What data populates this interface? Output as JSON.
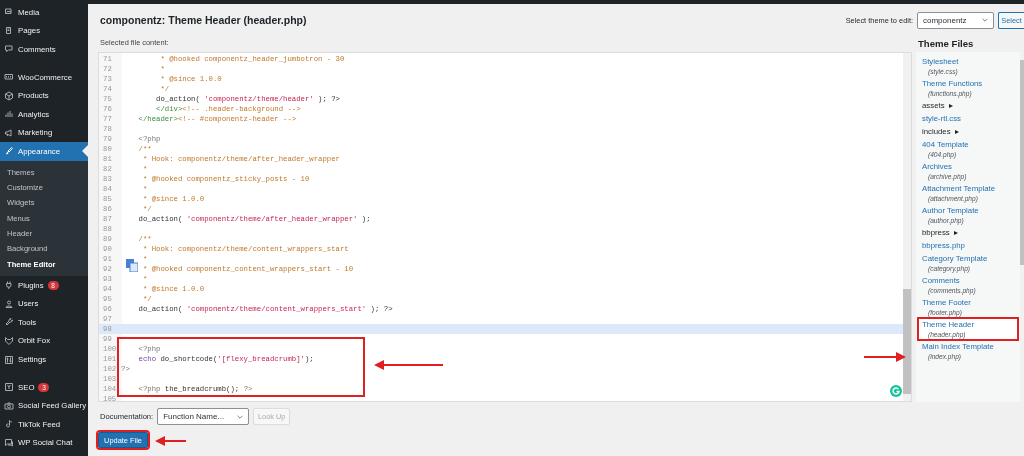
{
  "sidebar": {
    "sections": [
      {
        "items": [
          {
            "label": "Media",
            "selected": false
          },
          {
            "label": "Pages",
            "selected": false
          },
          {
            "label": "Comments",
            "selected": false
          }
        ]
      },
      {
        "items": [
          {
            "label": "WooCommerce",
            "selected": false
          },
          {
            "label": "Products",
            "selected": false
          },
          {
            "label": "Analytics",
            "selected": false
          },
          {
            "label": "Marketing",
            "selected": false
          },
          {
            "label": "Appearance",
            "selected": true,
            "children": [
              {
                "label": "Themes",
                "selected": false
              },
              {
                "label": "Customize",
                "selected": false
              },
              {
                "label": "Widgets",
                "selected": false
              },
              {
                "label": "Menus",
                "selected": false
              },
              {
                "label": "Header",
                "selected": false
              },
              {
                "label": "Background",
                "selected": false
              },
              {
                "label": "Theme Editor",
                "selected": true
              }
            ]
          },
          {
            "label": "Plugins",
            "selected": false,
            "badge": "8"
          },
          {
            "label": "Users",
            "selected": false
          },
          {
            "label": "Tools",
            "selected": false
          },
          {
            "label": "Orbit Fox",
            "selected": false
          },
          {
            "label": "Settings",
            "selected": false
          }
        ]
      },
      {
        "items": [
          {
            "label": "SEO",
            "selected": false,
            "badge": "3"
          },
          {
            "label": "Social Feed Gallery",
            "selected": false
          },
          {
            "label": "TikTok Feed",
            "selected": false
          },
          {
            "label": "WP Social Chat",
            "selected": false
          }
        ]
      }
    ]
  },
  "title": "componentz: Theme Header (header.php)",
  "theme_select": {
    "label": "Select theme to edit:",
    "value": "componentz",
    "button": "Select"
  },
  "editor": {
    "label": "Selected file content:",
    "lines": [
      {
        "number": "71",
        "active": false,
        "tokens": [
          {
            "kind": "comment",
            "text": "         * @hooked componentz_header_jumbotron - 30"
          }
        ]
      },
      {
        "number": "72",
        "active": false,
        "tokens": [
          {
            "kind": "comment",
            "text": "         *"
          }
        ]
      },
      {
        "number": "73",
        "active": false,
        "tokens": [
          {
            "kind": "comment",
            "text": "         * @since 1.0.0"
          }
        ]
      },
      {
        "number": "74",
        "active": false,
        "tokens": [
          {
            "kind": "comment",
            "text": "         */"
          }
        ]
      },
      {
        "number": "75",
        "active": false,
        "tokens": [
          {
            "kind": "plain",
            "text": "        do_action( "
          },
          {
            "kind": "string",
            "text": "'componentz/theme/header'"
          },
          {
            "kind": "plain",
            "text": " ); ?>"
          }
        ]
      },
      {
        "number": "76",
        "active": false,
        "tokens": [
          {
            "kind": "tag",
            "text": "        </div>"
          },
          {
            "kind": "comment",
            "text": "<!-- .header-background -->"
          }
        ]
      },
      {
        "number": "77",
        "active": false,
        "tokens": [
          {
            "kind": "tag",
            "text": "    </header>"
          },
          {
            "kind": "comment",
            "text": "<!-- #componentz-header -->"
          }
        ]
      },
      {
        "number": "78",
        "active": false
      },
      {
        "number": "79",
        "active": false,
        "tokens": [
          {
            "kind": "meta",
            "text": "    <?php"
          }
        ]
      },
      {
        "number": "80",
        "active": false,
        "tokens": [
          {
            "kind": "comment",
            "text": "    /**"
          }
        ]
      },
      {
        "number": "81",
        "active": false,
        "tokens": [
          {
            "kind": "comment",
            "text": "     * Hook: componentz/theme/after_header_wrapper"
          }
        ]
      },
      {
        "number": "82",
        "active": false,
        "tokens": [
          {
            "kind": "comment",
            "text": "     *"
          }
        ]
      },
      {
        "number": "83",
        "active": false,
        "tokens": [
          {
            "kind": "comment",
            "text": "     * @hooked componentz_sticky_posts - 10"
          }
        ]
      },
      {
        "number": "84",
        "active": false,
        "tokens": [
          {
            "kind": "comment",
            "text": "     *"
          }
        ]
      },
      {
        "number": "85",
        "active": false,
        "tokens": [
          {
            "kind": "comment",
            "text": "     * @since 1.0.0"
          }
        ]
      },
      {
        "number": "86",
        "active": false,
        "tokens": [
          {
            "kind": "comment",
            "text": "     */"
          }
        ]
      },
      {
        "number": "87",
        "active": false,
        "tokens": [
          {
            "kind": "plain",
            "text": "    do_action( "
          },
          {
            "kind": "string",
            "text": "'componentz/theme/after_header_wrapper'"
          },
          {
            "kind": "plain",
            "text": " );"
          }
        ]
      },
      {
        "number": "88",
        "active": false
      },
      {
        "number": "89",
        "active": false,
        "tokens": [
          {
            "kind": "comment",
            "text": "    /**"
          }
        ]
      },
      {
        "number": "90",
        "active": false,
        "tokens": [
          {
            "kind": "comment",
            "text": "     * Hook: componentz/theme/content_wrappers_start"
          }
        ]
      },
      {
        "number": "91",
        "active": false,
        "tokens": [
          {
            "kind": "comment",
            "text": "     *"
          }
        ]
      },
      {
        "number": "92",
        "active": false,
        "tokens": [
          {
            "kind": "comment",
            "text": "     * @hooked componentz_content_wrappers_start - 10"
          }
        ]
      },
      {
        "number": "93",
        "active": false,
        "tokens": [
          {
            "kind": "comment",
            "text": "     *"
          }
        ]
      },
      {
        "number": "94",
        "active": false,
        "tokens": [
          {
            "kind": "comment",
            "text": "     * @since 1.0.0"
          }
        ]
      },
      {
        "number": "95",
        "active": false,
        "tokens": [
          {
            "kind": "comment",
            "text": "     */"
          }
        ]
      },
      {
        "number": "96",
        "active": false,
        "tokens": [
          {
            "kind": "plain",
            "text": "    do_action( "
          },
          {
            "kind": "string",
            "text": "'componentz/theme/content_wrappers_start'"
          },
          {
            "kind": "plain",
            "text": " ); ?>"
          }
        ]
      },
      {
        "number": "97",
        "active": false
      },
      {
        "number": "98",
        "active": true
      },
      {
        "number": "99",
        "active": false
      },
      {
        "number": "100",
        "active": false,
        "tokens": [
          {
            "kind": "meta",
            "text": "    <?php"
          }
        ]
      },
      {
        "number": "101",
        "active": false,
        "tokens": [
          {
            "kind": "keyword",
            "text": "    echo"
          },
          {
            "kind": "plain",
            "text": " do_shortcode("
          },
          {
            "kind": "string",
            "text": "'[flexy_breadcrumb]'"
          },
          {
            "kind": "plain",
            "text": ");"
          }
        ]
      },
      {
        "number": "102",
        "active": false,
        "tokens": [
          {
            "kind": "meta",
            "text": "?>"
          }
        ]
      },
      {
        "number": "103",
        "active": false
      },
      {
        "number": "104",
        "active": false,
        "tokens": [
          {
            "kind": "meta",
            "text": "    <?php "
          },
          {
            "kind": "plain",
            "text": "the_breadcrumb(); "
          },
          {
            "kind": "meta",
            "text": "?>"
          }
        ]
      },
      {
        "number": "105",
        "active": false
      }
    ]
  },
  "theme_files": {
    "heading": "Theme Files",
    "items": [
      {
        "kind": "file",
        "label": "Stylesheet",
        "file": "(style.css)",
        "selected": false
      },
      {
        "kind": "file",
        "label": "Theme Functions",
        "file": "(functions.php)",
        "selected": false
      },
      {
        "kind": "folder",
        "label": "assets",
        "selected": false
      },
      {
        "kind": "file",
        "label": "style-rtl.css",
        "selected": false
      },
      {
        "kind": "folder",
        "label": "includes",
        "selected": false
      },
      {
        "kind": "file",
        "label": "404 Template",
        "file": "(404.php)",
        "selected": false
      },
      {
        "kind": "file",
        "label": "Archives",
        "file": "(archive.php)",
        "selected": false
      },
      {
        "kind": "file",
        "label": "Attachment Template",
        "file": "(attachment.php)",
        "selected": false
      },
      {
        "kind": "file",
        "label": "Author Template",
        "file": "(author.php)",
        "selected": false
      },
      {
        "kind": "folder",
        "label": "bbpress",
        "selected": false
      },
      {
        "kind": "file",
        "label": "bbpress.php",
        "selected": false
      },
      {
        "kind": "file",
        "label": "Category Template",
        "file": "(category.php)",
        "selected": false
      },
      {
        "kind": "file",
        "label": "Comments",
        "file": "(comments.php)",
        "selected": false
      },
      {
        "kind": "file",
        "label": "Theme Footer",
        "file": "(footer.php)",
        "selected": false
      },
      {
        "kind": "file",
        "label": "Theme Header",
        "file": "(header.php)",
        "selected": true
      },
      {
        "kind": "file",
        "label": "Main Index Template",
        "file": "(index.php)",
        "selected": false
      }
    ]
  },
  "documentation": {
    "label": "Documentation:",
    "select": "Function Name...",
    "button": "Look Up",
    "button_disabled": true
  },
  "update_button": "Update File"
}
